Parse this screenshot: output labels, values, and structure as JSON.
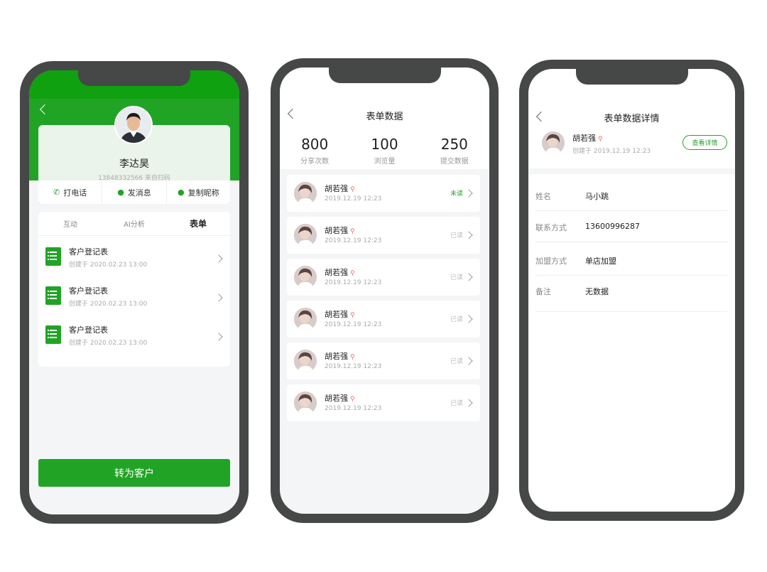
{
  "phone1": {
    "customer_name": "李达昊",
    "customer_sub": "13848332566  来自扫码",
    "actions": [
      {
        "label": "打电话",
        "icon": "phone-icon"
      },
      {
        "label": "发消息",
        "icon": "message-icon"
      },
      {
        "label": "复制昵称",
        "icon": "wechat-icon"
      }
    ],
    "tabs": [
      {
        "label": "互动",
        "active": false
      },
      {
        "label": "AI分析",
        "active": false
      },
      {
        "label": "表单",
        "active": true
      }
    ],
    "forms": [
      {
        "title": "客户登记表",
        "created": "创建于 2020.02.23 13:00"
      },
      {
        "title": "客户登记表",
        "created": "创建于 2020.02.23 13:00"
      },
      {
        "title": "客户登记表",
        "created": "创建于 2020.02.23 13:00"
      }
    ],
    "convert_button": "转为客户"
  },
  "phone2": {
    "title": "表单数据",
    "stats": [
      {
        "value": "800",
        "label": "分享次数"
      },
      {
        "value": "100",
        "label": "浏览量"
      },
      {
        "value": "250",
        "label": "提交数据"
      }
    ],
    "records": [
      {
        "name": "胡若强",
        "time": "2019.12.19 12:23",
        "status": "未读",
        "unread": true
      },
      {
        "name": "胡若强",
        "time": "2019.12.19 12:23",
        "status": "已读",
        "unread": false
      },
      {
        "name": "胡若强",
        "time": "2019.12.19 12:23",
        "status": "已读",
        "unread": false
      },
      {
        "name": "胡若强",
        "time": "2019.12.19 12:23",
        "status": "已读",
        "unread": false
      },
      {
        "name": "胡若强",
        "time": "2019.12.19 12:23",
        "status": "已读",
        "unread": false
      },
      {
        "name": "胡若强",
        "time": "2019.12.19 12:23",
        "status": "已读",
        "unread": false
      }
    ]
  },
  "phone3": {
    "title": "表单数据详情",
    "submitter_name": "胡若强",
    "submitter_time": "创建于 2019.12.19 12:23",
    "detail_button": "查看详情",
    "fields": [
      {
        "label": "姓名",
        "value": "马小跳"
      },
      {
        "label": "联系方式",
        "value": "13600996287"
      },
      {
        "label": "加盟方式",
        "value": "单店加盟"
      },
      {
        "label": "备注",
        "value": "无数据"
      }
    ]
  },
  "colors": {
    "brand_green": "#21a425",
    "frame": "#454846",
    "bg_gray": "#f4f5f7"
  }
}
